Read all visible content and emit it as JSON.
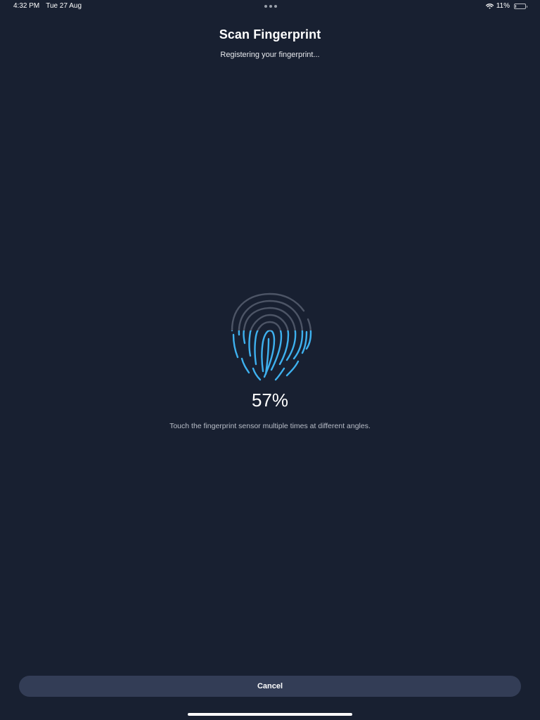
{
  "status_bar": {
    "time": "4:32 PM",
    "date": "Tue 27 Aug",
    "battery_percent": "11%",
    "battery_level": 0.11,
    "wifi_icon": "wifi-icon",
    "battery_icon": "battery-icon"
  },
  "header": {
    "title": "Scan Fingerprint",
    "subtitle": "Registering your fingerprint..."
  },
  "scan": {
    "progress_text": "57%",
    "progress_value": 0.57,
    "icon": "fingerprint-icon",
    "instruction": "Touch the fingerprint sensor multiple times at different angles."
  },
  "footer": {
    "cancel_label": "Cancel"
  },
  "colors": {
    "background": "#182031",
    "button": "#333d56",
    "scanned": "#3eb1ef",
    "unscanned": "#4d5566"
  }
}
